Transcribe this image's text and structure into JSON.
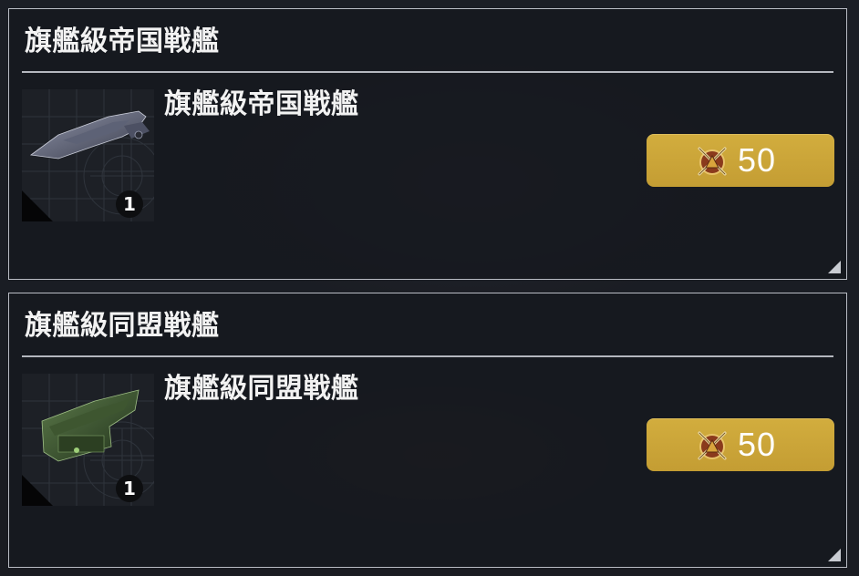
{
  "items": [
    {
      "title": "旗艦級帝国戦艦",
      "name": "旗艦級帝国戦艦",
      "quantity": "1",
      "price": "50",
      "thumbnail_icon": "imperial-battleship-icon",
      "currency_icon": "crossed-swords-emblem-icon"
    },
    {
      "title": "旗艦級同盟戦艦",
      "name": "旗艦級同盟戦艦",
      "quantity": "1",
      "price": "50",
      "thumbnail_icon": "alliance-battleship-icon",
      "currency_icon": "crossed-swords-emblem-icon"
    }
  ],
  "colors": {
    "price_button": "#c9a33a",
    "card_border": "#b9bcc4",
    "background": "#1a1d24"
  }
}
